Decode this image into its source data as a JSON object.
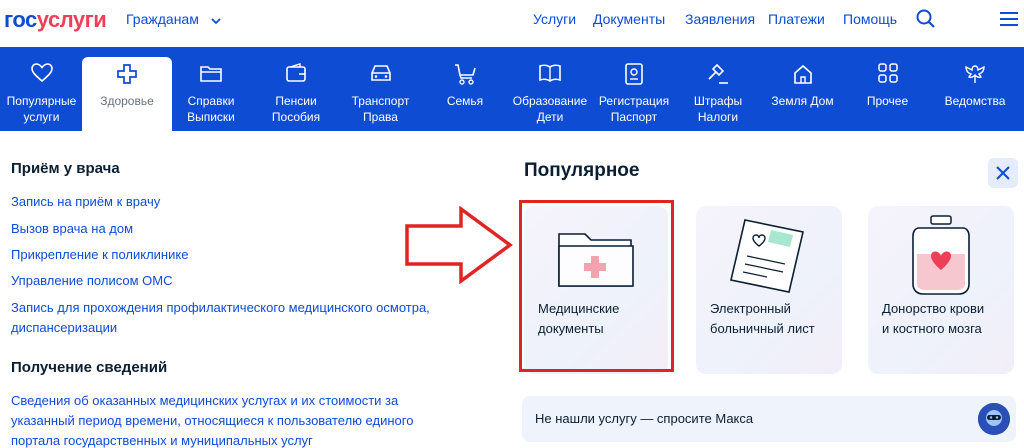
{
  "header": {
    "logo_part1": "гос",
    "logo_part2": "услуги",
    "citizens_label": "Гражданам",
    "nav": [
      "Услуги",
      "Документы",
      "Заявления",
      "Платежи",
      "Помощь"
    ]
  },
  "categories": [
    {
      "line1": "Популярные",
      "line2": "услуги",
      "icon": "heart-icon"
    },
    {
      "line1": "Здоровье",
      "line2": "",
      "icon": "medical-cross-icon",
      "active": true
    },
    {
      "line1": "Справки",
      "line2": "Выписки",
      "icon": "folder-icon"
    },
    {
      "line1": "Пенсии",
      "line2": "Пособия",
      "icon": "wallet-icon"
    },
    {
      "line1": "Транспорт",
      "line2": "Права",
      "icon": "car-icon"
    },
    {
      "line1": "Семья",
      "line2": "",
      "icon": "stroller-icon"
    },
    {
      "line1": "Образование",
      "line2": "Дети",
      "icon": "book-icon"
    },
    {
      "line1": "Регистрация",
      "line2": "Паспорт",
      "icon": "passport-icon"
    },
    {
      "line1": "Штрафы",
      "line2": "Налоги",
      "icon": "gavel-icon"
    },
    {
      "line1": "Земля Дом",
      "line2": "",
      "icon": "house-icon"
    },
    {
      "line1": "Прочее",
      "line2": "",
      "icon": "grid-icon"
    },
    {
      "line1": "Ведомства",
      "line2": "",
      "icon": "eagle-icon"
    }
  ],
  "left": {
    "section1": {
      "title": "Приём у врача",
      "links": [
        "Запись на приём к врачу",
        "Вызов врача на дом",
        "Прикрепление к поликлинике",
        "Управление полисом ОМС"
      ],
      "multi_link_line1": "Запись для прохождения профилактического медицинского осмотра,",
      "multi_link_line2": "диспансеризации"
    },
    "section2": {
      "title": "Получение сведений",
      "link_line1": "Сведения об оказанных медицинских услугах и их стоимости за",
      "link_line2": "указанный период времени, относящиеся к пользователю единого",
      "link_line3": "портала государственных и муниципальных услуг"
    }
  },
  "popular": {
    "title": "Популярное",
    "cards": [
      {
        "line1": "Медицинские",
        "line2": "документы",
        "icon": "medical-folder-icon"
      },
      {
        "line1": "Электронный",
        "line2": "больничный лист",
        "icon": "sick-leave-document-icon"
      },
      {
        "line1": "Донорство крови",
        "line2": "и костного мозга",
        "icon": "blood-bag-icon"
      }
    ],
    "ask_text": "Не нашли услугу — спросите Макса"
  },
  "colors": {
    "brand_blue": "#0d4cd3",
    "brand_red": "#ee3f58",
    "annotation_red": "#e02424"
  }
}
